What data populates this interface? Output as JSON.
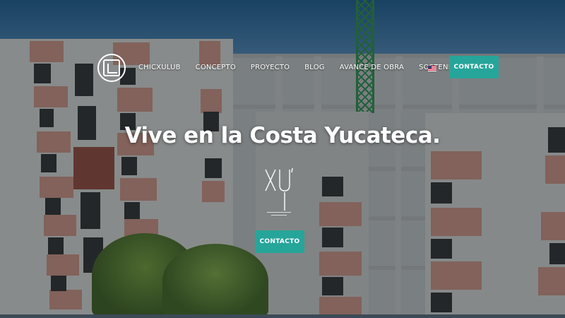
{
  "nav": {
    "items": [
      "CHICXULUB",
      "CONCEPTO",
      "PROYECTO",
      "BLOG",
      "AVANCE DE OBRA",
      "SOSTENIBILIDAD"
    ],
    "contact_label": "CONTACTO",
    "language_flag_icon": "us-flag-icon"
  },
  "hero": {
    "headline": "Vive en la Costa Yucateca.",
    "brand_mark": "XU",
    "cta_label": "CONTACTO"
  },
  "colors": {
    "accent": "#26a59a",
    "text": "#ffffff"
  }
}
